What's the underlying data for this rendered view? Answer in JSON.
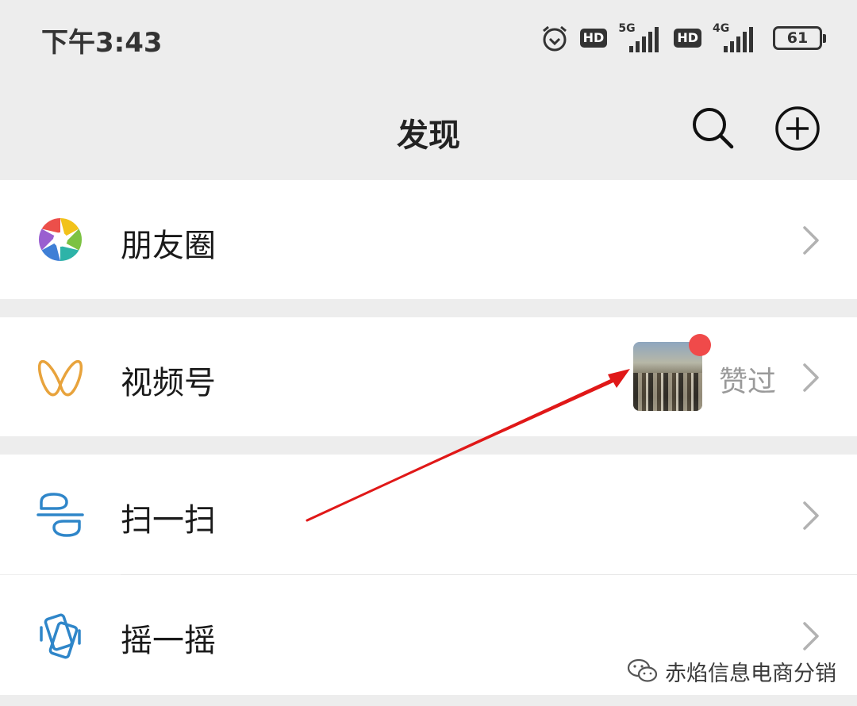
{
  "status_bar": {
    "time": "下午3:43",
    "hd_badge": "HD",
    "signal_1_label": "5G",
    "signal_2_label": "4G",
    "battery": "61"
  },
  "nav": {
    "title": "发现"
  },
  "menu": {
    "moments": "朋友圈",
    "channels": "视频号",
    "channels_status": "赞过",
    "scan": "扫一扫",
    "shake": "摇一摇"
  },
  "watermark": {
    "text": "赤焰信息电商分销"
  },
  "colors": {
    "background": "#ededed",
    "cell": "#ffffff",
    "red_dot": "#f04a4a",
    "arrow": "#e01818",
    "channels_icon": "#e8a33c",
    "scan_icon": "#2f86c9"
  }
}
